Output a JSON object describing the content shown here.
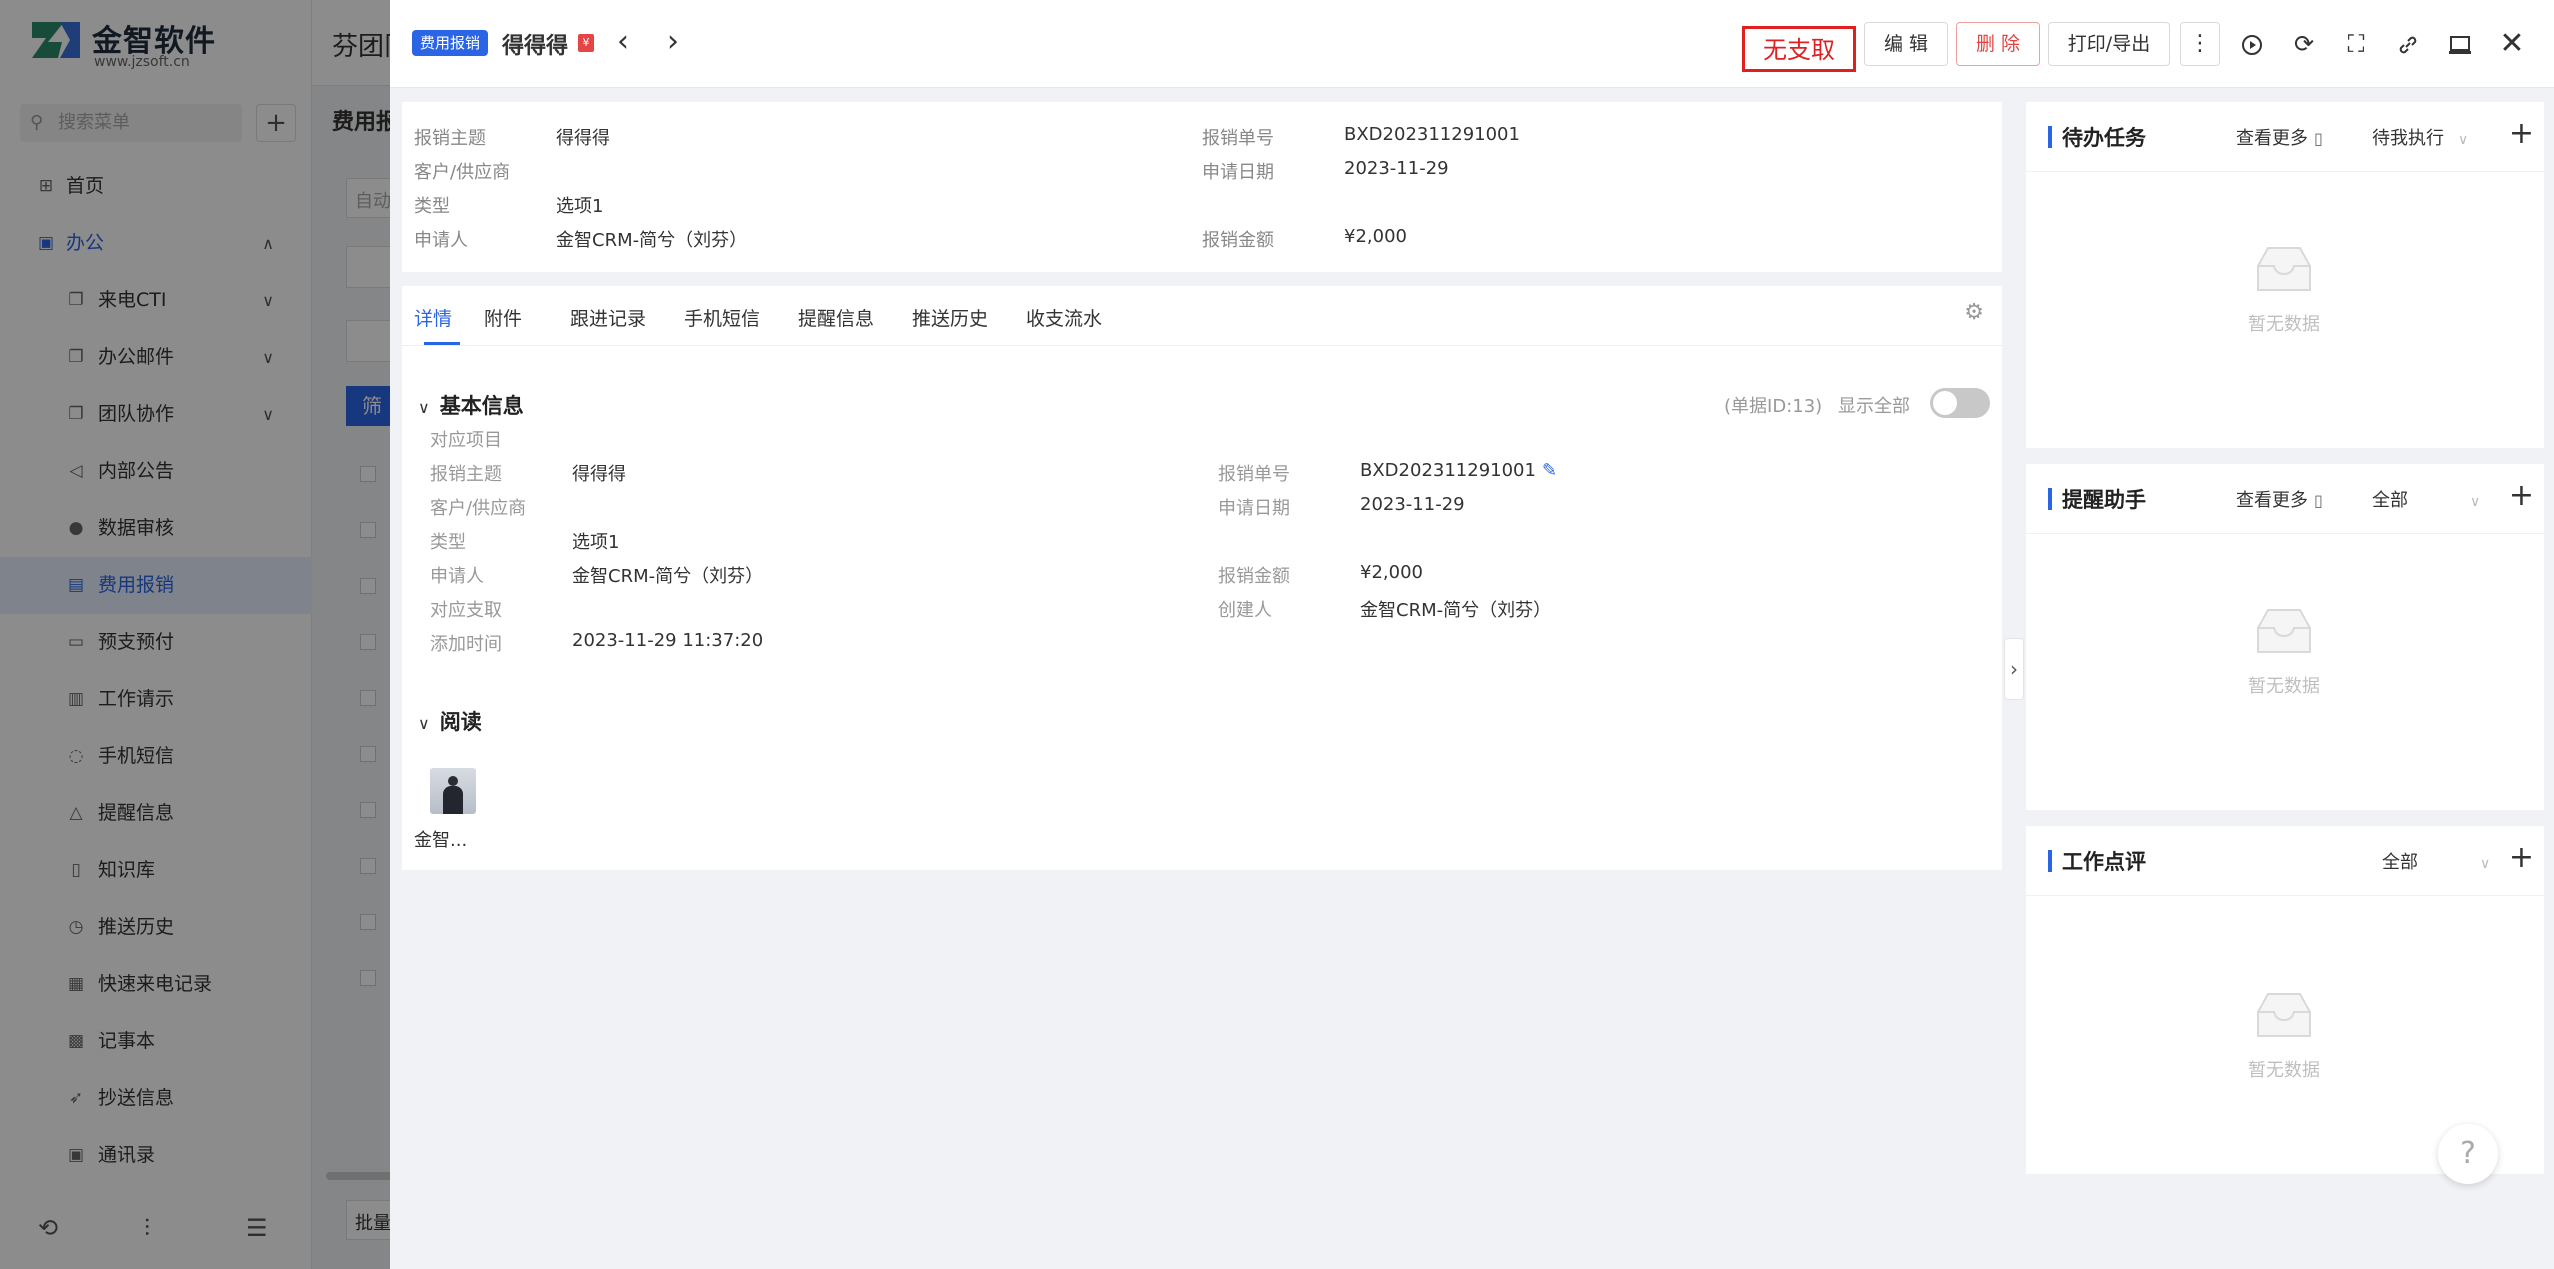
{
  "app": {
    "logo_text": "金智软件",
    "logo_sub": "www.jzsoft.cn",
    "search_placeholder": "搜索菜单",
    "header_title": "芬团队",
    "page_title": "费用报",
    "input_hint": "自动",
    "filter_label": "筛",
    "batch_label": "批量"
  },
  "menu": [
    {
      "label": "首页",
      "icon": "home-icon",
      "type": "top"
    },
    {
      "label": "办公",
      "icon": "briefcase-icon",
      "type": "group"
    },
    {
      "label": "来电CTI",
      "icon": "window-icon",
      "type": "sub",
      "arrow": true
    },
    {
      "label": "办公邮件",
      "icon": "window-icon",
      "type": "sub",
      "arrow": true
    },
    {
      "label": "团队协作",
      "icon": "window-icon",
      "type": "sub",
      "arrow": true
    },
    {
      "label": "内部公告",
      "icon": "speaker-icon",
      "type": "sub"
    },
    {
      "label": "数据审核",
      "icon": "user-icon",
      "type": "sub"
    },
    {
      "label": "费用报销",
      "icon": "receipt-icon",
      "type": "sub",
      "active": true
    },
    {
      "label": "预支预付",
      "icon": "wallet-icon",
      "type": "sub"
    },
    {
      "label": "工作请示",
      "icon": "doc-icon",
      "type": "sub"
    },
    {
      "label": "手机短信",
      "icon": "chat-icon",
      "type": "sub"
    },
    {
      "label": "提醒信息",
      "icon": "bell-icon",
      "type": "sub"
    },
    {
      "label": "知识库",
      "icon": "book-icon",
      "type": "sub"
    },
    {
      "label": "推送历史",
      "icon": "clock-icon",
      "type": "sub"
    },
    {
      "label": "快速来电记录",
      "icon": "note-icon",
      "type": "sub"
    },
    {
      "label": "记事本",
      "icon": "notebook-icon",
      "type": "sub"
    },
    {
      "label": "抄送信息",
      "icon": "send-icon",
      "type": "sub"
    },
    {
      "label": "通讯录",
      "icon": "contacts-icon",
      "type": "sub"
    }
  ],
  "drawer": {
    "module_tag": "费用报销",
    "title": "得得得",
    "stamp": "无支取",
    "buttons": {
      "edit": "编 辑",
      "delete": "删 除",
      "print": "打印/导出"
    },
    "summary": {
      "subject_label": "报销主题",
      "subject": "得得得",
      "customer_label": "客户/供应商",
      "type_label": "类型",
      "type": "选项1",
      "applicant_label": "申请人",
      "applicant": "金智CRM-简兮（刘芬）",
      "number_label": "报销单号",
      "number": "BXD202311291001",
      "date_label": "申请日期",
      "date": "2023-11-29",
      "amount_label": "报销金额",
      "amount": "¥2,000"
    },
    "tabs": [
      "详情",
      "附件",
      "跟进记录",
      "手机短信",
      "提醒信息",
      "推送历史",
      "收支流水"
    ],
    "basic": {
      "section_title": "基本信息",
      "doc_id": "(单据ID:13)",
      "show_all": "显示全部",
      "project_label": "对应项目",
      "subject_label": "报销主题",
      "subject": "得得得",
      "customer_label": "客户/供应商",
      "type_label": "类型",
      "type": "选项1",
      "applicant_label": "申请人",
      "applicant": "金智CRM-简兮（刘芬）",
      "expense_label": "对应支取",
      "added_label": "添加时间",
      "added": "2023-11-29 11:37:20",
      "number_label": "报销单号",
      "number": "BXD202311291001",
      "date_label": "申请日期",
      "date": "2023-11-29",
      "amount_label": "报销金额",
      "amount": "¥2,000",
      "creator_label": "创建人",
      "creator": "金智CRM-简兮（刘芬）"
    },
    "read": {
      "section_title": "阅读",
      "reader_name": "金智..."
    }
  },
  "panels": [
    {
      "title": "待办任务",
      "more": "查看更多",
      "filter": "待我执行",
      "empty": "暂无数据"
    },
    {
      "title": "提醒助手",
      "more": "查看更多",
      "filter": "全部",
      "empty": "暂无数据"
    },
    {
      "title": "工作点评",
      "more": "",
      "filter": "全部",
      "empty": "暂无数据"
    }
  ],
  "colors": {
    "accent": "#2a65e6",
    "danger": "#e02020",
    "overlay": "rgba(0,0,0,0.45)"
  }
}
